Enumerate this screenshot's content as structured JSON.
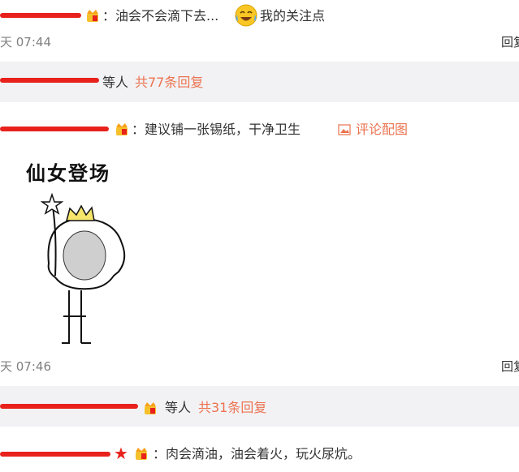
{
  "comment1": {
    "text": "：油会不会滴下去...",
    "after_emoji": "我的关注点",
    "time": "天 07:44",
    "reply": "回复"
  },
  "thread1": {
    "suffix": "等人",
    "count_link": "共77条回复"
  },
  "comment2": {
    "text": "：建议铺一张锡纸，干净卫生",
    "image_link": "评论配图",
    "sticker_text": "仙女登场",
    "time": "天 07:46",
    "reply": "回复"
  },
  "thread2": {
    "suffix": "等人",
    "count_link": "共31条回复"
  },
  "comment3": {
    "text": "：肉会滴油，油会着火，玩火尿炕。"
  },
  "colors": {
    "link_orange": "#eb7350",
    "band_grey": "#f2f2f5",
    "redaction_red": "#e8211c"
  },
  "icons": [
    "vip-badge-icon",
    "laughing-cry-emoji-icon",
    "image-icon",
    "star-icon"
  ]
}
